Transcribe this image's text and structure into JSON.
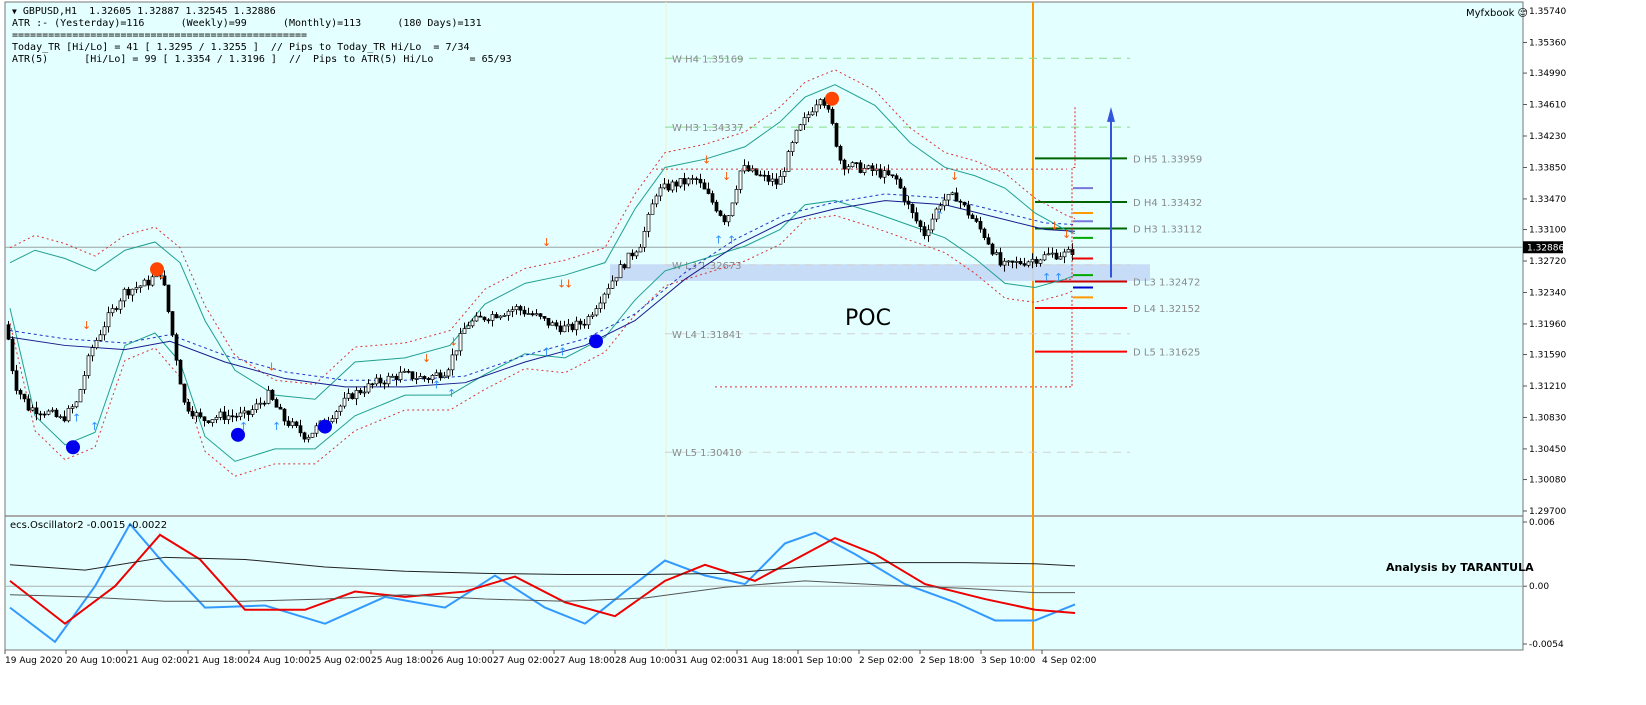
{
  "header": {
    "symbol_line": "GBPUSD,H1  1.32605 1.32887 1.32545 1.32886",
    "atr_line": "ATR :- (Yesterday)=116      (Weekly)=99      (Monthly)=113      (180 Days)=131",
    "separator": "=================================================",
    "today_line": "Today_TR [Hi/Lo] = 41 [ 1.3295 / 1.3255 ]  // Pips to Today_TR Hi/Lo  = 7/34",
    "atr5_line": "ATR(5)      [Hi/Lo] = 99 [ 1.3354 / 1.3196 ]  //  Pips to ATR(5) Hi/Lo      = 65/93"
  },
  "branding": {
    "myfxbook": "Myfxbook",
    "analysis": "Analysis by TARANTULA"
  },
  "annotations": {
    "poc": "POC"
  },
  "oscillator": {
    "title": "ecs.Oscillator2 -0.0015 -0.0022"
  },
  "colors": {
    "background": "#e3ffff",
    "bull_candle": "#ffffff",
    "bear_candle": "#000000",
    "bollinger": "#20a090",
    "ma": "#1a1a8c",
    "orange_vline": "#ff9900",
    "signal_dot_high": "#ff4500",
    "signal_dot_low": "#0000ee",
    "osc_blue": "#3399ff",
    "osc_red": "#ee0000",
    "poc_zone": "#c3d8f5"
  },
  "chart_data": {
    "type": "candlestick",
    "symbol": "GBPUSD",
    "timeframe": "H1",
    "ohlc_last": {
      "open": 1.32605,
      "high": 1.32887,
      "low": 1.32545,
      "close": 1.32886
    },
    "current_price": 1.32886,
    "y_axis": {
      "ticks": [
        "1.35740",
        "1.35360",
        "1.34990",
        "1.34610",
        "1.34230",
        "1.33850",
        "1.33470",
        "1.33100",
        "1.32720",
        "1.32340",
        "1.31960",
        "1.31590",
        "1.31210",
        "1.30830",
        "1.30450",
        "1.30080",
        "1.29700"
      ],
      "ylim": [
        1.297,
        1.3574
      ]
    },
    "x_axis": {
      "labels": [
        "19 Aug 2020",
        "20 Aug 10:00",
        "21 Aug 02:00",
        "21 Aug 18:00",
        "24 Aug 10:00",
        "25 Aug 02:00",
        "25 Aug 18:00",
        "26 Aug 10:00",
        "27 Aug 02:00",
        "27 Aug 18:00",
        "28 Aug 10:00",
        "31 Aug 02:00",
        "31 Aug 18:00",
        "1 Sep 10:00",
        "2 Sep 02:00",
        "2 Sep 18:00",
        "3 Sep 10:00",
        "4 Sep 02:00"
      ]
    },
    "price_path": [
      [
        0,
        1.3195
      ],
      [
        8,
        1.3125
      ],
      [
        22,
        1.3095
      ],
      [
        40,
        1.309
      ],
      [
        55,
        1.308
      ],
      [
        70,
        1.31
      ],
      [
        85,
        1.3165
      ],
      [
        100,
        1.32
      ],
      [
        118,
        1.3235
      ],
      [
        140,
        1.3245
      ],
      [
        155,
        1.326
      ],
      [
        165,
        1.319
      ],
      [
        178,
        1.31
      ],
      [
        195,
        1.308
      ],
      [
        215,
        1.3085
      ],
      [
        240,
        1.3085
      ],
      [
        262,
        1.311
      ],
      [
        278,
        1.308
      ],
      [
        300,
        1.306
      ],
      [
        320,
        1.308
      ],
      [
        345,
        1.311
      ],
      [
        370,
        1.3125
      ],
      [
        395,
        1.3135
      ],
      [
        420,
        1.313
      ],
      [
        440,
        1.314
      ],
      [
        460,
        1.3195
      ],
      [
        480,
        1.3205
      ],
      [
        510,
        1.3215
      ],
      [
        530,
        1.3205
      ],
      [
        545,
        1.3195
      ],
      [
        562,
        1.319
      ],
      [
        580,
        1.32
      ],
      [
        598,
        1.3235
      ],
      [
        615,
        1.3265
      ],
      [
        635,
        1.3295
      ],
      [
        650,
        1.3355
      ],
      [
        668,
        1.3365
      ],
      [
        690,
        1.337
      ],
      [
        705,
        1.3345
      ],
      [
        720,
        1.332
      ],
      [
        735,
        1.3385
      ],
      [
        752,
        1.3375
      ],
      [
        772,
        1.3365
      ],
      [
        790,
        1.3425
      ],
      [
        805,
        1.3455
      ],
      [
        815,
        1.3475
      ],
      [
        825,
        1.344
      ],
      [
        835,
        1.339
      ],
      [
        850,
        1.3385
      ],
      [
        870,
        1.338
      ],
      [
        890,
        1.337
      ],
      [
        905,
        1.333
      ],
      [
        918,
        1.3305
      ],
      [
        935,
        1.3345
      ],
      [
        950,
        1.335
      ],
      [
        965,
        1.3325
      ],
      [
        980,
        1.33
      ],
      [
        995,
        1.3265
      ],
      [
        1012,
        1.327
      ],
      [
        1030,
        1.3275
      ],
      [
        1045,
        1.328
      ],
      [
        1060,
        1.328
      ],
      [
        1072,
        1.3289
      ]
    ],
    "bollinger_upper": [
      [
        5,
        1.327
      ],
      [
        30,
        1.3285
      ],
      [
        60,
        1.3275
      ],
      [
        90,
        1.326
      ],
      [
        120,
        1.3285
      ],
      [
        150,
        1.3295
      ],
      [
        175,
        1.327
      ],
      [
        200,
        1.32
      ],
      [
        230,
        1.314
      ],
      [
        270,
        1.311
      ],
      [
        310,
        1.3105
      ],
      [
        350,
        1.315
      ],
      [
        400,
        1.3155
      ],
      [
        445,
        1.317
      ],
      [
        480,
        1.322
      ],
      [
        520,
        1.3245
      ],
      [
        560,
        1.3255
      ],
      [
        600,
        1.327
      ],
      [
        630,
        1.3335
      ],
      [
        660,
        1.3385
      ],
      [
        700,
        1.3395
      ],
      [
        740,
        1.341
      ],
      [
        775,
        1.344
      ],
      [
        800,
        1.347
      ],
      [
        830,
        1.3485
      ],
      [
        870,
        1.346
      ],
      [
        905,
        1.3415
      ],
      [
        940,
        1.3385
      ],
      [
        970,
        1.3375
      ],
      [
        1000,
        1.336
      ],
      [
        1030,
        1.333
      ],
      [
        1060,
        1.331
      ],
      [
        1070,
        1.3305
      ]
    ],
    "bollinger_lower": [
      [
        5,
        1.3215
      ],
      [
        30,
        1.3085
      ],
      [
        60,
        1.305
      ],
      [
        90,
        1.3065
      ],
      [
        120,
        1.317
      ],
      [
        150,
        1.3185
      ],
      [
        175,
        1.315
      ],
      [
        200,
        1.306
      ],
      [
        230,
        1.303
      ],
      [
        270,
        1.3045
      ],
      [
        310,
        1.3045
      ],
      [
        350,
        1.3085
      ],
      [
        400,
        1.311
      ],
      [
        445,
        1.311
      ],
      [
        480,
        1.3135
      ],
      [
        520,
        1.316
      ],
      [
        560,
        1.3155
      ],
      [
        600,
        1.318
      ],
      [
        630,
        1.3225
      ],
      [
        660,
        1.326
      ],
      [
        700,
        1.3275
      ],
      [
        740,
        1.329
      ],
      [
        775,
        1.331
      ],
      [
        800,
        1.334
      ],
      [
        830,
        1.3345
      ],
      [
        870,
        1.333
      ],
      [
        905,
        1.3315
      ],
      [
        940,
        1.33
      ],
      [
        970,
        1.3275
      ],
      [
        1000,
        1.3245
      ],
      [
        1030,
        1.324
      ],
      [
        1060,
        1.325
      ],
      [
        1070,
        1.3255
      ]
    ],
    "moving_average": [
      [
        5,
        1.318
      ],
      [
        60,
        1.317
      ],
      [
        120,
        1.3165
      ],
      [
        165,
        1.3175
      ],
      [
        220,
        1.315
      ],
      [
        280,
        1.313
      ],
      [
        340,
        1.312
      ],
      [
        400,
        1.312
      ],
      [
        460,
        1.3125
      ],
      [
        520,
        1.315
      ],
      [
        580,
        1.317
      ],
      [
        630,
        1.32
      ],
      [
        680,
        1.325
      ],
      [
        730,
        1.329
      ],
      [
        780,
        1.332
      ],
      [
        830,
        1.3335
      ],
      [
        880,
        1.3345
      ],
      [
        940,
        1.334
      ],
      [
        990,
        1.3325
      ],
      [
        1040,
        1.331
      ],
      [
        1070,
        1.3308
      ]
    ],
    "weekly_pivots": [
      {
        "label": "W  H4 1.35169",
        "value": 1.35169
      },
      {
        "label": "W  H3 1.34337",
        "value": 1.34337
      },
      {
        "label": "W  L3 1.32673",
        "value": 1.32673
      },
      {
        "label": "W  L4 1.31841",
        "value": 1.31841
      },
      {
        "label": "W  L5 1.30410",
        "value": 1.3041
      }
    ],
    "daily_pivots": [
      {
        "label": "D  H5 1.33959",
        "value": 1.33959,
        "color": "#006400"
      },
      {
        "label": "D  H4 1.33432",
        "value": 1.33432,
        "color": "#006400"
      },
      {
        "label": "D  H3 1.33112",
        "value": 1.33112,
        "color": "#006400"
      },
      {
        "label": "D  L3 1.32472",
        "value": 1.32472,
        "color": "#cc0000"
      },
      {
        "label": "D  L4 1.32152",
        "value": 1.32152,
        "color": "#ff0000"
      },
      {
        "label": "D  L5 1.31625",
        "value": 1.31625,
        "color": "#ff0000"
      }
    ],
    "signal_dots": [
      {
        "x": 68,
        "y": 1.3047,
        "kind": "low"
      },
      {
        "x": 152,
        "y": 1.3262,
        "kind": "high"
      },
      {
        "x": 233,
        "y": 1.3062,
        "kind": "low"
      },
      {
        "x": 320,
        "y": 1.3072,
        "kind": "low"
      },
      {
        "x": 591,
        "y": 1.3175,
        "kind": "low"
      },
      {
        "x": 827,
        "y": 1.3468,
        "kind": "high"
      }
    ],
    "poc_zone": [
      1.3248,
      1.3268
    ],
    "oscillator": {
      "ylim": [
        -0.0054,
        0.006
      ],
      "ticks": [
        "0.006",
        "0.00",
        "-0.0054"
      ],
      "series": [
        {
          "color": "#3399ff",
          "points": [
            [
              5,
              -0.002
            ],
            [
              50,
              -0.0052
            ],
            [
              90,
              0.0
            ],
            [
              125,
              0.0058
            ],
            [
              160,
              0.002
            ],
            [
              200,
              -0.002
            ],
            [
              260,
              -0.0018
            ],
            [
              320,
              -0.0035
            ],
            [
              380,
              -0.001
            ],
            [
              440,
              -0.002
            ],
            [
              490,
              0.001
            ],
            [
              540,
              -0.002
            ],
            [
              580,
              -0.0035
            ],
            [
              620,
              -0.0005
            ],
            [
              660,
              0.0024
            ],
            [
              700,
              0.001
            ],
            [
              740,
              0.0002
            ],
            [
              780,
              0.004
            ],
            [
              810,
              0.005
            ],
            [
              850,
              0.003
            ],
            [
              900,
              0.0002
            ],
            [
              950,
              -0.0015
            ],
            [
              990,
              -0.0032
            ],
            [
              1030,
              -0.0032
            ],
            [
              1070,
              -0.0017
            ]
          ]
        },
        {
          "color": "#ee0000",
          "points": [
            [
              5,
              0.0005
            ],
            [
              60,
              -0.0035
            ],
            [
              110,
              0.0
            ],
            [
              155,
              0.0048
            ],
            [
              195,
              0.0025
            ],
            [
              240,
              -0.0022
            ],
            [
              300,
              -0.0022
            ],
            [
              350,
              -0.0005
            ],
            [
              400,
              -0.001
            ],
            [
              460,
              -0.0005
            ],
            [
              510,
              0.0009
            ],
            [
              560,
              -0.0015
            ],
            [
              610,
              -0.0028
            ],
            [
              660,
              0.0005
            ],
            [
              700,
              0.002
            ],
            [
              750,
              0.0005
            ],
            [
              800,
              0.003
            ],
            [
              830,
              0.0045
            ],
            [
              870,
              0.003
            ],
            [
              920,
              0.0002
            ],
            [
              980,
              -0.0012
            ],
            [
              1030,
              -0.0022
            ],
            [
              1070,
              -0.0025
            ]
          ]
        },
        {
          "color": "#222222",
          "points": [
            [
              5,
              0.002
            ],
            [
              80,
              0.0015
            ],
            [
              160,
              0.0027
            ],
            [
              240,
              0.0025
            ],
            [
              320,
              0.0018
            ],
            [
              400,
              0.0014
            ],
            [
              480,
              0.0012
            ],
            [
              560,
              0.0011
            ],
            [
              640,
              0.0011
            ],
            [
              720,
              0.0012
            ],
            [
              800,
              0.0018
            ],
            [
              880,
              0.0022
            ],
            [
              960,
              0.0022
            ],
            [
              1030,
              0.0021
            ],
            [
              1070,
              0.0019
            ]
          ]
        },
        {
          "color": "#555555",
          "points": [
            [
              5,
              -0.0008
            ],
            [
              80,
              -0.001
            ],
            [
              160,
              -0.0014
            ],
            [
              240,
              -0.0014
            ],
            [
              320,
              -0.0012
            ],
            [
              400,
              -0.0008
            ],
            [
              480,
              -0.0012
            ],
            [
              560,
              -0.0014
            ],
            [
              640,
              -0.0011
            ],
            [
              720,
              -0.0001
            ],
            [
              800,
              0.0005
            ],
            [
              880,
              0.0001
            ],
            [
              960,
              -0.0002
            ],
            [
              1030,
              -0.0006
            ],
            [
              1070,
              -0.0006
            ]
          ]
        }
      ]
    }
  }
}
